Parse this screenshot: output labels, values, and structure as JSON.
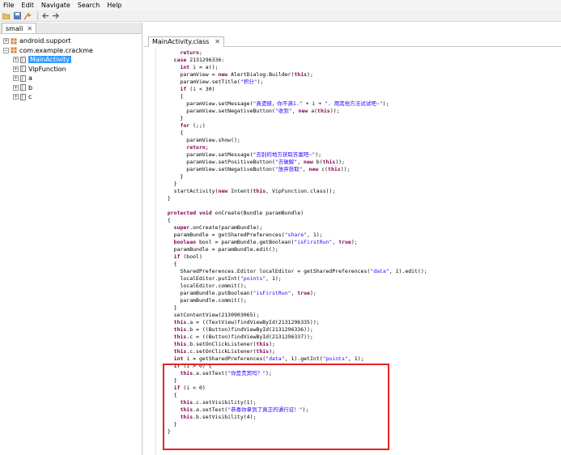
{
  "menu": [
    "File",
    "Edit",
    "Navigate",
    "Search",
    "Help"
  ],
  "toolbar": {
    "icons": [
      "open-icon",
      "save-icon",
      "jump-icon",
      "back-arrow-icon",
      "forward-arrow-icon"
    ]
  },
  "left_panel": {
    "tab_label": "smali",
    "tree": [
      {
        "label": "android.support",
        "type": "package",
        "depth": 0,
        "expanded": false
      },
      {
        "label": "com.example.crackme",
        "type": "package",
        "depth": 0,
        "expanded": true
      },
      {
        "label": "MainActivity",
        "type": "class",
        "depth": 1,
        "expanded": false,
        "selected": true
      },
      {
        "label": "VipFunction",
        "type": "class",
        "depth": 1,
        "expanded": false
      },
      {
        "label": "a",
        "type": "class",
        "depth": 1,
        "expanded": false
      },
      {
        "label": "b",
        "type": "class",
        "depth": 1,
        "expanded": false
      },
      {
        "label": "c",
        "type": "class",
        "depth": 1,
        "expanded": false
      }
    ]
  },
  "editor": {
    "tab_label": "MainActivity.class",
    "code_lines": [
      "      return;",
      "    case 2131296336:",
      "      int i = a();",
      "      paramView = new AlertDialog.Builder(this);",
      "      paramView.setTitle(\"积分\");",
      "      if (i < 30)",
      "      {",
      "        paramView.setMessage(\"真遗憾，你不满1.\" + i + \". 用其他方法试试吧~\");",
      "        paramView.setNegativeButton(\"收到\", new a(this));",
      "      }",
      "      for (;;)",
      "      {",
      "        paramView.show();",
      "        return;",
      "        paramView.setMessage(\"去别的地方获取答案吧~\");",
      "        paramView.setPositiveButton(\"去破解\", new b(this));",
      "        paramView.setNegativeButton(\"放弃获取\", new c(this));",
      "      }",
      "    }",
      "    startActivity(new Intent(this, VipFunction.class));",
      "  }",
      "",
      "  protected void onCreate(Bundle paramBundle)",
      "  {",
      "    super.onCreate(paramBundle);",
      "    paramBundle = getSharedPreferences(\"share\", 1);",
      "    boolean bool = paramBundle.getBoolean(\"isFirstRun\", true);",
      "    paramBundle = paramBundle.edit();",
      "    if (bool)",
      "    {",
      "      SharedPreferences.Editor localEditor = getSharedPreferences(\"data\", 1).edit();",
      "      localEditor.putInt(\"points\", 1);",
      "      localEditor.commit();",
      "      paramBundle.putBoolean(\"isFirstRun\", true);",
      "      paramBundle.commit();",
      "    }",
      "    setContentView(2130903065);",
      "    this.a = ((TextView)findViewById(2131296335));",
      "    this.b = ((Button)findViewById(2131296336));",
      "    this.c = ((Button)findViewById(2131296337));",
      "    this.b.setOnClickListener(this);",
      "    this.c.setOnClickListener(this);",
      "    int i = getSharedPreferences(\"data\", 1).getInt(\"points\", 1);",
      "    if (i > 0) {",
      "      this.a.setText(\"你是贵宾吗？\");",
      "    }",
      "    if (i < 0)",
      "    {",
      "      this.c.setVisibility(1);",
      "      this.a.setText(\"恭喜你拿到了真正的通行证！\");",
      "      this.b.setVisibility(4);",
      "    }",
      "  }"
    ]
  },
  "colors": {
    "keyword": "#7f0055",
    "string": "#2a00ff",
    "field": "#0000c0",
    "highlight_box": "#e52424",
    "selection": "#3399ff"
  }
}
